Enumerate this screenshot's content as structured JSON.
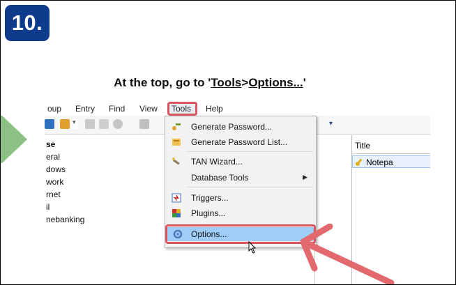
{
  "step_badge": "10.",
  "instruction": {
    "prefix": "At the top, go to '",
    "tools": "Tools",
    "sep": ">",
    "options": "Options...",
    "suffix": "'"
  },
  "menubar": {
    "items": [
      "oup",
      "Entry",
      "Find",
      "View",
      "Tools",
      "Help"
    ]
  },
  "tree": {
    "items": [
      "se",
      "eral",
      "dows",
      "work",
      "rnet",
      "il",
      "nebanking"
    ]
  },
  "entry_list": {
    "column_title": "Title",
    "row_1": "Notepa"
  },
  "tools_menu": {
    "items": [
      {
        "label": "Generate Password...",
        "icon": "key-wand-icon"
      },
      {
        "label": "Generate Password List...",
        "icon": "key-list-icon"
      },
      {
        "label": "TAN Wizard...",
        "icon": "wizard-wand-icon"
      },
      {
        "label": "Database Tools",
        "icon": "",
        "has_submenu": true
      },
      {
        "label": "Triggers...",
        "icon": "triggers-icon"
      },
      {
        "label": "Plugins...",
        "icon": "plugins-icon"
      },
      {
        "label": "Options...",
        "icon": "options-gear-icon"
      }
    ]
  },
  "colors": {
    "badge": "#0f3b8c",
    "highlight_red": "#d9555f",
    "menu_selection": "#9fcdf7",
    "arrow_green": "#8cc084"
  }
}
